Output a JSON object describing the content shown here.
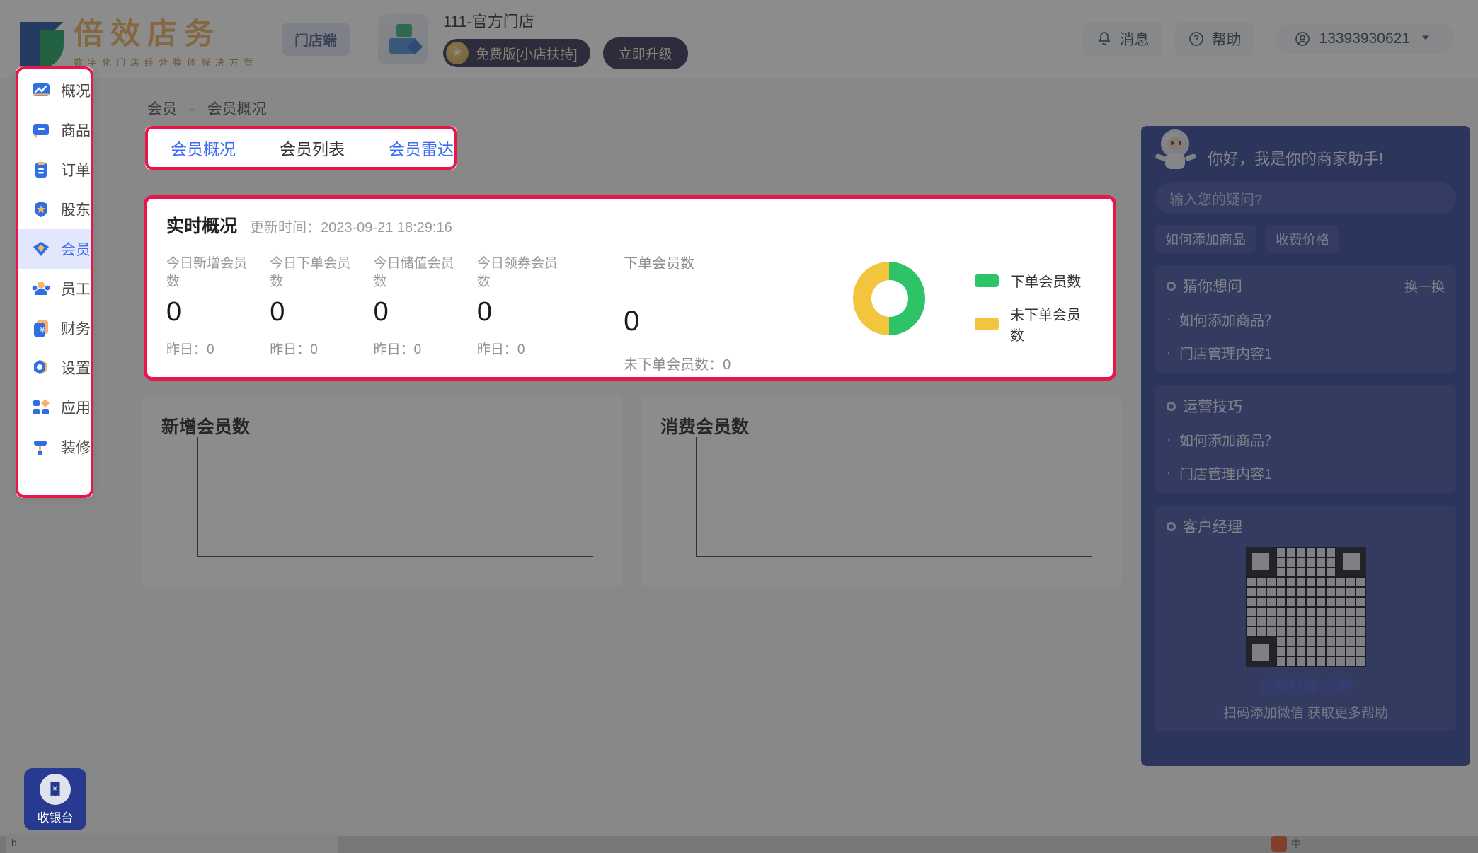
{
  "topbar": {
    "logo_cn": "倍效店务",
    "logo_sub": "数字化门店经营整体解决方案",
    "mendian_badge": "门店端",
    "shop_name": "111-官方门店",
    "plan_label": "免费版[小店扶持]",
    "upgrade_label": "立即升级",
    "message_label": "消息",
    "help_label": "帮助",
    "user_phone": "13393930621",
    "icons": {
      "bell": "bell-icon",
      "question": "question-circle-icon",
      "user": "user-circle-icon",
      "caret": "chevron-down-icon"
    }
  },
  "sidebar": {
    "items": [
      {
        "label": "概况",
        "icon": "chart-line-icon",
        "active": false
      },
      {
        "label": "商品",
        "icon": "goods-box-icon",
        "active": false
      },
      {
        "label": "订单",
        "icon": "clipboard-icon",
        "active": false
      },
      {
        "label": "股东",
        "icon": "shield-star-icon",
        "active": false
      },
      {
        "label": "会员",
        "icon": "diamond-icon",
        "active": true
      },
      {
        "label": "员工",
        "icon": "people-icon",
        "active": false
      },
      {
        "label": "财务",
        "icon": "yuan-card-icon",
        "active": false
      },
      {
        "label": "设置",
        "icon": "gear-icon",
        "active": false
      },
      {
        "label": "应用",
        "icon": "apps-grid-icon",
        "active": false
      },
      {
        "label": "装修",
        "icon": "paint-roller-icon",
        "active": false
      }
    ],
    "cashier_label": "收银台",
    "cashier_icon": "receipt-yuan-icon"
  },
  "breadcrumb": {
    "parent": "会员",
    "sep": "-",
    "current": "会员概况"
  },
  "tabs": [
    {
      "label": "会员概况",
      "state": "active"
    },
    {
      "label": "会员列表",
      "state": "normal"
    },
    {
      "label": "会员雷达",
      "state": "link"
    }
  ],
  "realtime": {
    "title": "实时概况",
    "update_label": "更新时间：",
    "update_time": "2023-09-21 18:29:16",
    "kpis": [
      {
        "label": "今日新增会员数",
        "value": "0",
        "sub": "昨日：0"
      },
      {
        "label": "今日下单会员数",
        "value": "0",
        "sub": "昨日：0"
      },
      {
        "label": "今日储值会员数",
        "value": "0",
        "sub": "昨日：0"
      },
      {
        "label": "今日领券会员数",
        "value": "0",
        "sub": "昨日：0"
      }
    ],
    "order_members": {
      "label": "下单会员数",
      "value": "0",
      "sub": "未下单会员数：0"
    },
    "legend": [
      {
        "label": "下单会员数",
        "color": "#2ec367"
      },
      {
        "label": "未下单会员数",
        "color": "#f3c53f"
      }
    ]
  },
  "chart_data": [
    {
      "type": "line",
      "title": "新增会员数",
      "categories": [],
      "values": [],
      "xlabel": "",
      "ylabel": "",
      "grid": false
    },
    {
      "type": "line",
      "title": "消费会员数",
      "categories": [],
      "values": [],
      "xlabel": "",
      "ylabel": "",
      "grid": false
    }
  ],
  "donut_data": {
    "type": "pie",
    "title": "下单会员数",
    "labels": [
      "下单会员数",
      "未下单会员数"
    ],
    "values": [
      50,
      50
    ],
    "colors": [
      "#2ec367",
      "#f3c53f"
    ]
  },
  "assistant": {
    "greeting": "你好，我是你的商家助手!",
    "input_placeholder": "输入您的疑问?",
    "chips": [
      "如何添加商品",
      "收费价格"
    ],
    "panels": [
      {
        "title": "猜你想问",
        "action": "换一换",
        "items": [
          "如何添加商品？",
          "门店管理内容1"
        ]
      },
      {
        "title": "运营技巧",
        "action": "",
        "items": [
          "如何添加商品？",
          "门店管理内容1"
        ]
      }
    ],
    "manager_panel": {
      "title": "客户经理",
      "qr_name": "企服经理-小数",
      "qr_tip": "扫码添加微信 获取更多帮助"
    }
  },
  "watermark": {
    "cn": "倍效店务",
    "sub": "数字化门店经营整体解决方案"
  },
  "taskbar": {
    "url_text": "h"
  }
}
